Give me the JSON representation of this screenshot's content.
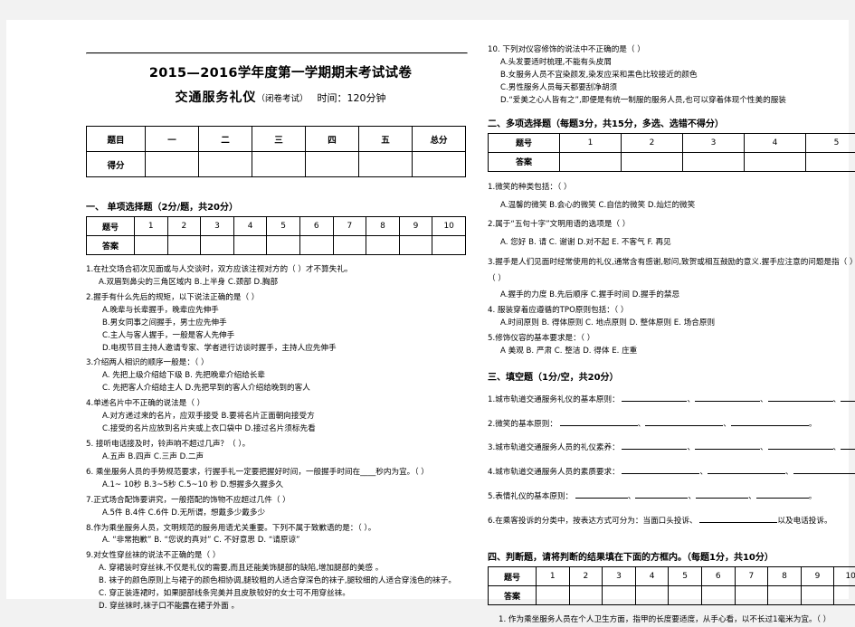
{
  "exam": {
    "title": "2015—2016学年度第一学期期末考试试卷",
    "subject": "交通服务礼仪",
    "exam_type": "（闭卷考试）",
    "time": "时间：120分钟"
  },
  "score_table": {
    "row_label_1": "题目",
    "row_label_2": "得分",
    "columns": [
      "一",
      "二",
      "三",
      "四",
      "五",
      "总分"
    ]
  },
  "section1": {
    "heading": "一、  单项选择题（2分/题，共20分）",
    "answer_table": {
      "label_num": "题号",
      "label_ans": "答案",
      "numbers": [
        "1",
        "2",
        "3",
        "4",
        "5",
        "6",
        "7",
        "8",
        "9",
        "10"
      ]
    },
    "questions": [
      {
        "stem": "1.在社交场合初次见面或与人交谈时，双方应该注视对方的（        ）才不算失礼。",
        "options_lines": [
          "A.双眉到鼻尖的三角区域内            B.上半身           C.颈部            D.胸部"
        ]
      },
      {
        "stem": "2.握手有什么先后的规矩，以下说法正确的是（        ）",
        "options_lines": [
          "A.晚辈与长辈握手，晚辈应先伸手",
          "B.男女同事之间握手，男士应先伸手",
          "C.主人与客人握手，一般是客人先伸手",
          "D.电视节目主持人邀请专家、学者进行访谈时握手，主持人应先伸手"
        ]
      },
      {
        "stem": "3.介绍两人相识的顺序一般是：（        ）",
        "options_lines": [
          "A. 先把上级介绍给下级           B. 先把晚辈介绍给长辈",
          "C. 先把客人介绍给主人           D.先把早到的客人介绍给晚到的客人"
        ]
      },
      {
        "stem": "4.单递名片中不正确的说法是（        ）",
        "options_lines": [
          "A.对方递过来的名片，应双手接受                B.要将名片正面朝向接受方",
          "C.接受的名片应放到名片夹或上衣口袋中          D.接过名片须标先看"
        ]
      },
      {
        "stem": "5. 接听电话接及时，铃声响不超过几声？（        ）。",
        "options_lines": [
          "A.五声              B.四声              C.三声              D.二声"
        ]
      },
      {
        "stem": "6. 乘坐服务人员的手势规范要求，行握手礼一定要把握好时间，一般握手时间在____秒内为宜。（                ）",
        "options_lines": [
          "A.1~ 10秒         B.3~5秒          C.5~10 秒          D.想握多久握多久"
        ]
      },
      {
        "stem": "7.正式场合配饰要讲究，一般搭配的饰物不应超过几件（        ）",
        "options_lines": [
          "A.5件                B.4件               C.6件       D.无所谓，想戴多少戴多少"
        ]
      },
      {
        "stem": "8.作为乘坐服务人员，文明规范的服务用语尤关重要。下列不属于致歉语的是：（            ）。",
        "options_lines": [
          "A. “非常抱歉”     B. “您说的真对”      C.  不好意思    D. “请原谅”"
        ]
      },
      {
        "stem": "9.对女性穿丝袜的说法不正确的是（            ）",
        "options_lines": [
          "A. 穿裙装时穿丝袜,不仅是礼仪的需要,而且还能美饰腿部的缺陷,增加腿部的美感 。",
          "B. 袜子的颜色原则上与裙子的颜色相协调,腿较粗的人适合穿深色的袜子,腿较细的人适合穿浅色的袜子。",
          "C. 穿正装连裙时，如果腿部线条完美并且皮肤较好的女士可不用穿丝袜。",
          "D. 穿丝袜时,袜子口不能露在裙子外面 。"
        ]
      },
      {
        "stem": "10. 下列对仪容修饰的说法中不正确的是（            ）",
        "options_lines": [
          "A.头发要适时梳理,不能有头皮屑",
          "B.女服务人员不宜染颜发,染发应采和黑色比较接近的颜色",
          "C.男性服务人员每天都要刮净胡须",
          "D.“爱美之心人皆有之”,即便是有统一制服的服务人员,也可以穿着体现个性美的服装"
        ]
      }
    ]
  },
  "section2": {
    "heading": "二、多项选择题（每题3分，共15分，多选、选错不得分）",
    "answer_table": {
      "label_num": "题号",
      "label_ans": "答案",
      "numbers": [
        "1",
        "2",
        "3",
        "4",
        "5"
      ]
    },
    "questions": [
      {
        "stem": "1.微笑的种类包括：（            ）",
        "options_lines": [
          "A.温馨的微笑           B.会心的微笑          C.自信的微笑        D.灿烂的微笑"
        ]
      },
      {
        "stem": "2.属于“五句十字”文明用语的选项是（              ）",
        "options_lines": [
          "A. 您好        B. 请        C. 谢谢        D.对不起     E. 不客气      F. 再见"
        ]
      },
      {
        "stem": "3.握手是人们见面时经常使用的礼仪,通常含有感谢,慰问,致贺或相互鼓励的意义.握手应注意的问题是指（              ）",
        "options_lines": [
          "A.握手的力度         B.先后顺序          C.握手时间         D.握手的禁忌"
        ]
      },
      {
        "stem": "4. 服装穿着应遵循的TPO原则包括：（              ）",
        "options_lines": [
          "A.时间原则        B. 得体原则       C. 地点原则      D.  整体原则      E. 场合原则"
        ]
      },
      {
        "stem": "5.修饰仪容的基本要求是：（              ）",
        "options_lines": [
          "A  美观        B. 严肃        C. 整洁      D. 得体       E. 庄重"
        ]
      }
    ]
  },
  "section3": {
    "heading": "三、填空题（1分/空，共20分）",
    "questions": [
      {
        "text": "1.城市轨道交通服务礼仪的基本原则：",
        "blanks": 5,
        "size": "fb-md",
        "tail": "。"
      },
      {
        "text": "2.微笑的基本原则：",
        "blanks": 3,
        "size": "fb-lg",
        "tail": "。"
      },
      {
        "text": "3.城市轨道交通服务人员的礼仪素养：",
        "blanks": 4,
        "size": "fb-md",
        "tail": "。"
      },
      {
        "text": "4.城市轨道交通服务人员的素质要求：",
        "blanks": 3,
        "size": "fb-lg",
        "tail": "。"
      },
      {
        "text": "5.表情礼仪的基本原则：",
        "blanks": 4,
        "size": "fb-md",
        "tail": "。"
      },
      {
        "text": "6.在乘客投诉的分类中，按表达方式可分为：当面口头投诉、",
        "blanks": 1,
        "size": "fb-lg",
        "tail": "以及电话投诉。"
      }
    ]
  },
  "section4": {
    "heading": "四、判断题，请将判断的结果填在下面的方框内。（每题1分，共10分）",
    "answer_table": {
      "label_num": "题号",
      "label_ans": "答案",
      "numbers": [
        "1",
        "2",
        "3",
        "4",
        "5",
        "6",
        "7",
        "8",
        "9",
        "10"
      ]
    },
    "questions": [
      {
        "stem": "1. 作为乘坐服务人员在个人卫生方面，指甲的长度要适度，从手心看，以不长过1毫米为宜。（              ）"
      }
    ]
  },
  "footer_mark": "-"
}
